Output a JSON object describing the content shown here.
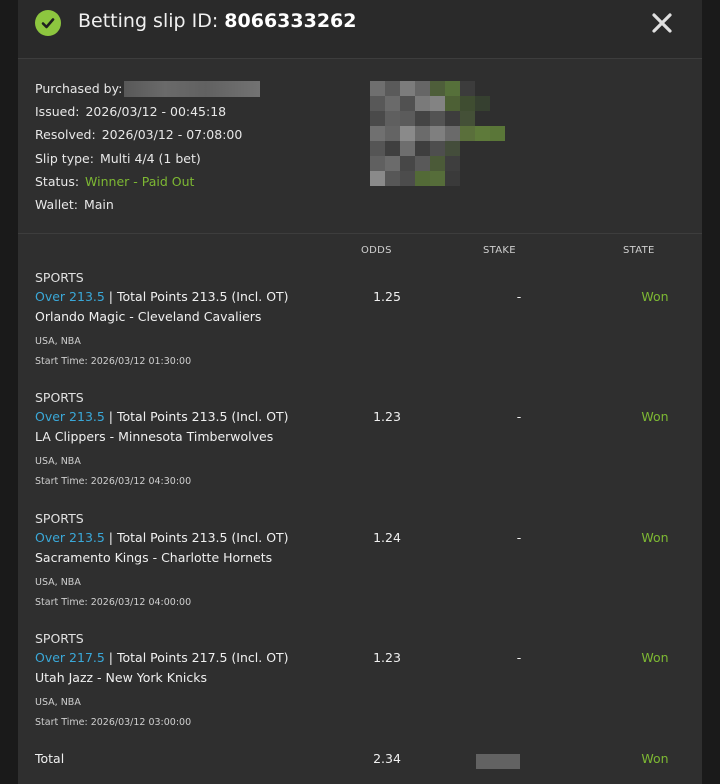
{
  "header": {
    "title_prefix": "Betting slip ID:",
    "slip_id": "8066333262"
  },
  "info": {
    "purchased_by_label": "Purchased by:",
    "issued_label": "Issued:",
    "issued_value": "2026/03/12 - 00:45:18",
    "resolved_label": "Resolved:",
    "resolved_value": "2026/03/12 - 07:08:00",
    "slip_type_label": "Slip type:",
    "slip_type_value": "Multi 4/4 (1 bet)",
    "status_label": "Status:",
    "status_value": "Winner - Paid Out",
    "wallet_label": "Wallet:",
    "wallet_value": "Main"
  },
  "columns": {
    "odds": "ODDS",
    "stake": "STAKE",
    "state": "STATE"
  },
  "bets": [
    {
      "category": "SPORTS",
      "selection": "Over 213.5",
      "market": " | Total Points 213.5 (Incl. OT)",
      "teams": "Orlando Magic - Cleveland Cavaliers",
      "league": "USA, NBA",
      "start": "Start Time: 2026/03/12 01:30:00",
      "odds": "1.25",
      "stake": "-",
      "state": "Won"
    },
    {
      "category": "SPORTS",
      "selection": "Over 213.5",
      "market": " | Total Points 213.5 (Incl. OT)",
      "teams": "LA Clippers - Minnesota Timberwolves",
      "league": "USA, NBA",
      "start": "Start Time: 2026/03/12 04:30:00",
      "odds": "1.23",
      "stake": "-",
      "state": "Won"
    },
    {
      "category": "SPORTS",
      "selection": "Over 213.5",
      "market": " | Total Points 213.5 (Incl. OT)",
      "teams": "Sacramento Kings - Charlotte Hornets",
      "league": "USA, NBA",
      "start": "Start Time: 2026/03/12 04:00:00",
      "odds": "1.24",
      "stake": "-",
      "state": "Won"
    },
    {
      "category": "SPORTS",
      "selection": "Over 217.5",
      "market": " | Total Points 217.5 (Incl. OT)",
      "teams": "Utah Jazz - New York Knicks",
      "league": "USA, NBA",
      "start": "Start Time: 2026/03/12 03:00:00",
      "odds": "1.23",
      "stake": "-",
      "state": "Won"
    }
  ],
  "total": {
    "label": "Total",
    "odds": "2.34",
    "state": "Won"
  },
  "colors": {
    "accent_green": "#7db833",
    "selection_blue": "#3aa8d8",
    "modal_bg": "#2f2f2f"
  },
  "icons": {
    "status": "check-circle-icon",
    "close": "close-icon"
  }
}
